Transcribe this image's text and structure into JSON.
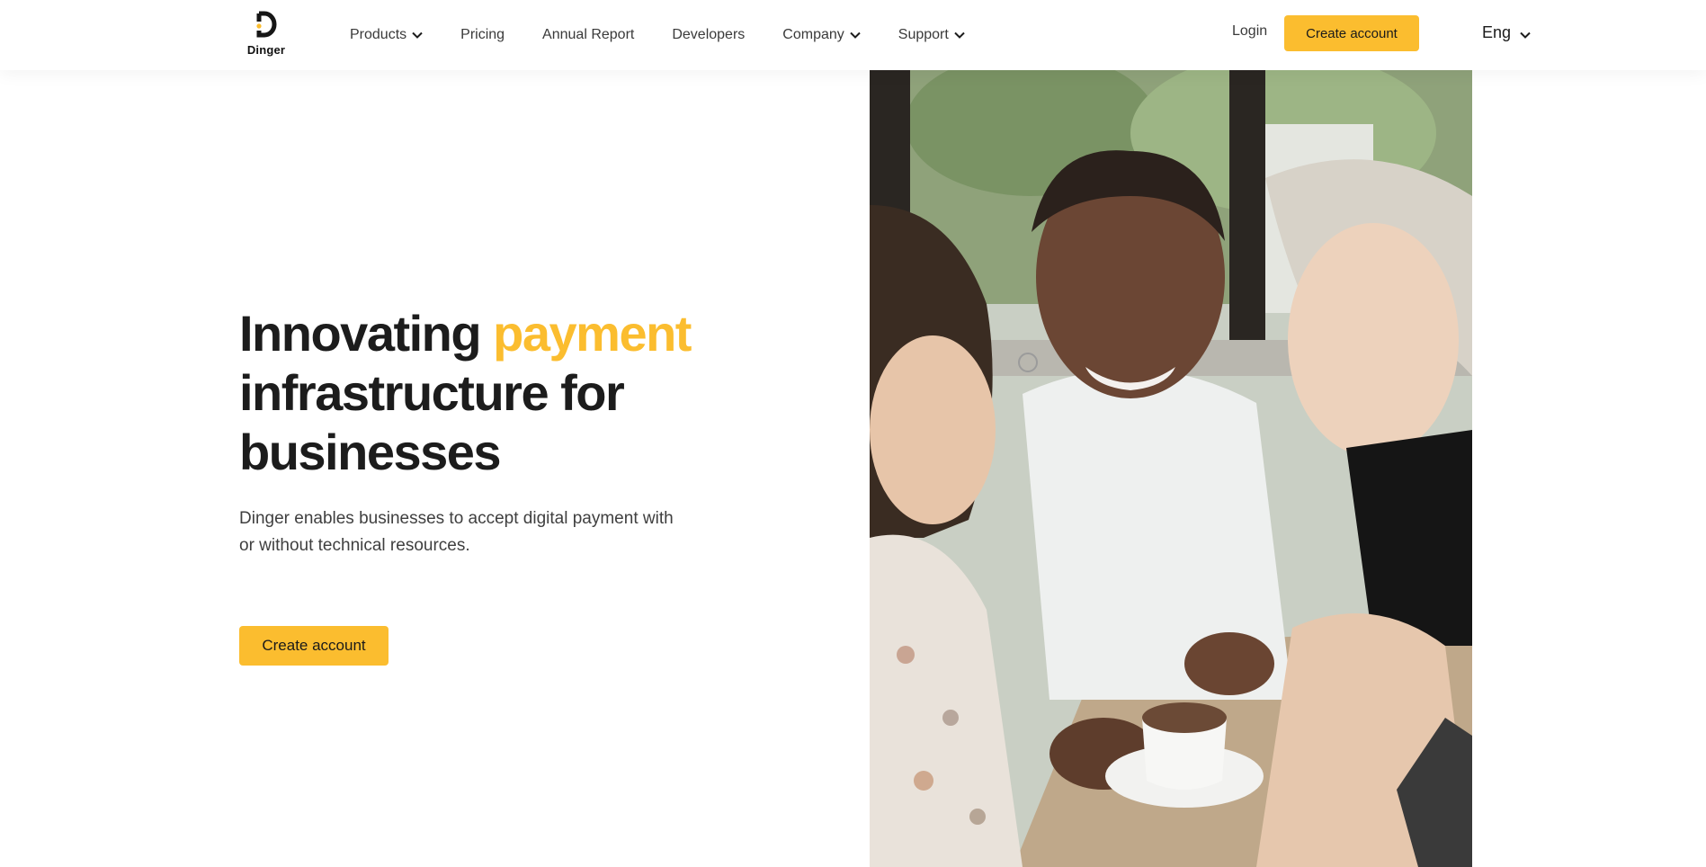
{
  "header": {
    "logo_text": "Dinger",
    "nav": [
      {
        "label": "Products",
        "dropdown": true
      },
      {
        "label": "Pricing",
        "dropdown": false
      },
      {
        "label": "Annual Report",
        "dropdown": false
      },
      {
        "label": "Developers",
        "dropdown": false
      },
      {
        "label": "Company",
        "dropdown": true
      },
      {
        "label": "Support",
        "dropdown": true
      }
    ],
    "login_label": "Login",
    "create_account_label": "Create account",
    "language": "Eng"
  },
  "hero": {
    "title_part1": "Innovating ",
    "title_accent": "payment",
    "title_part2": "infrastructure for businesses",
    "description": "Dinger enables businesses to accept digital payment with or without technical resources.",
    "cta_label": "Create account"
  },
  "colors": {
    "accent": "#fbbd2f",
    "text": "#1c1c1c"
  }
}
